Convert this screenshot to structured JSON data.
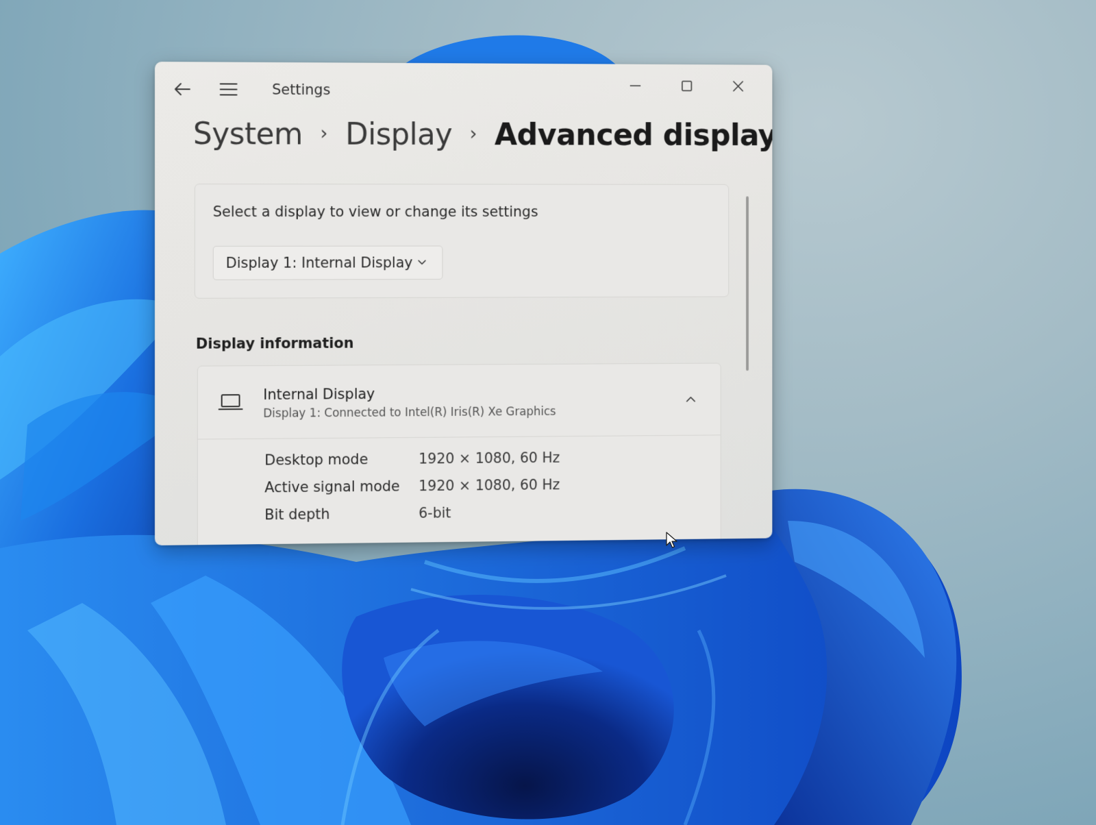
{
  "window": {
    "app_title": "Settings",
    "back_icon": "back-arrow-icon",
    "menu_icon": "hamburger-menu-icon",
    "controls": {
      "minimize_icon": "minimize-icon",
      "maximize_icon": "maximize-icon",
      "close_icon": "close-icon"
    }
  },
  "breadcrumb": {
    "items": [
      "System",
      "Display",
      "Advanced display"
    ],
    "separator": "›"
  },
  "display_selector": {
    "prompt": "Select a display to view or change its settings",
    "selected": "Display 1: Internal Display",
    "chevron_icon": "chevron-down-icon"
  },
  "display_information": {
    "heading": "Display information",
    "device": {
      "icon": "laptop-icon",
      "name": "Internal Display",
      "description": "Display 1: Connected to Intel(R) Iris(R) Xe Graphics",
      "expand_icon": "chevron-up-icon"
    },
    "rows": [
      {
        "label": "Desktop mode",
        "value": "1920 × 1080, 60 Hz"
      },
      {
        "label": "Active signal mode",
        "value": "1920 × 1080, 60 Hz"
      },
      {
        "label": "Bit depth",
        "value": "6-bit"
      }
    ]
  },
  "colors": {
    "wallpaper_blue": "#1565d8",
    "window_bg": "#e9e8e6",
    "text_primary": "#1a1a1a"
  }
}
